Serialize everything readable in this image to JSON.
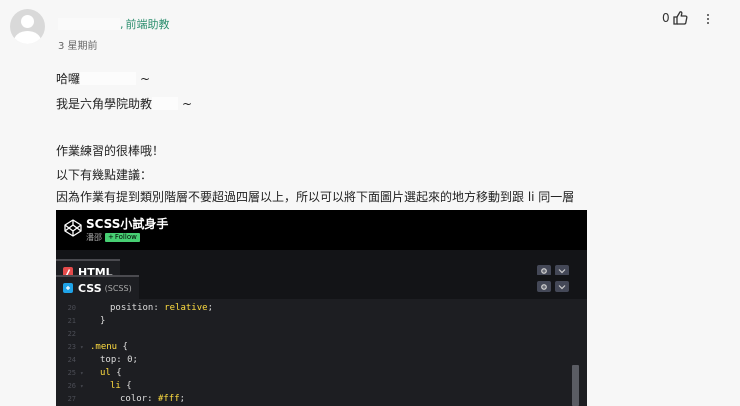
{
  "comment": {
    "role_separator": ",",
    "role": "前端助教",
    "time": "3 星期前",
    "like_count": "0",
    "lines": {
      "greeting_prefix": "哈囉",
      "greeting_suffix": "~",
      "intro_prefix": "我是六角學院助教",
      "intro_suffix": "~",
      "praise": "作業練習的很棒哦！",
      "advice_title": "以下有幾點建議：",
      "advice": "因為作業有提到類別階層不要超過四層以上，所以可以將下面圖片選起來的地方移動到跟 li 同一層"
    }
  },
  "embed": {
    "pen_title": "SCSS小試身手",
    "pen_author": "潘邵",
    "follow_label": "Follow",
    "tabs": [
      {
        "label": "HTML",
        "sub": ""
      },
      {
        "label": "CSS",
        "sub": "(SCSS)"
      }
    ],
    "code_lines": [
      {
        "ln": "20",
        "fold": "",
        "indent": 2,
        "tokens": [
          [
            "prop",
            "position"
          ],
          [
            "punc",
            ": "
          ],
          [
            "val",
            "relative"
          ],
          [
            "punc",
            ";"
          ]
        ]
      },
      {
        "ln": "21",
        "fold": "",
        "indent": 1,
        "tokens": [
          [
            "punc",
            "}"
          ]
        ]
      },
      {
        "ln": "22",
        "fold": "",
        "indent": 0,
        "tokens": []
      },
      {
        "ln": "23",
        "fold": "▾",
        "indent": 0,
        "tokens": [
          [
            "sel",
            ".menu"
          ],
          [
            "punc",
            " {"
          ]
        ]
      },
      {
        "ln": "24",
        "fold": "",
        "indent": 1,
        "tokens": [
          [
            "prop",
            "top"
          ],
          [
            "punc",
            ": "
          ],
          [
            "num",
            "0"
          ],
          [
            "punc",
            ";"
          ]
        ]
      },
      {
        "ln": "25",
        "fold": "▾",
        "indent": 1,
        "tokens": [
          [
            "sel",
            "ul"
          ],
          [
            "punc",
            " {"
          ]
        ]
      },
      {
        "ln": "26",
        "fold": "▾",
        "indent": 2,
        "tokens": [
          [
            "sel",
            "li"
          ],
          [
            "punc",
            " {"
          ]
        ]
      },
      {
        "ln": "27",
        "fold": "",
        "indent": 3,
        "tokens": [
          [
            "prop",
            "color"
          ],
          [
            "punc",
            ": "
          ],
          [
            "val",
            "#fff"
          ],
          [
            "punc",
            ";"
          ]
        ]
      }
    ]
  },
  "colors": {
    "accent": "#2d8f6f",
    "html_icon": "#e54b4b",
    "css_icon": "#1fa3e8",
    "follow": "#47cf73"
  }
}
